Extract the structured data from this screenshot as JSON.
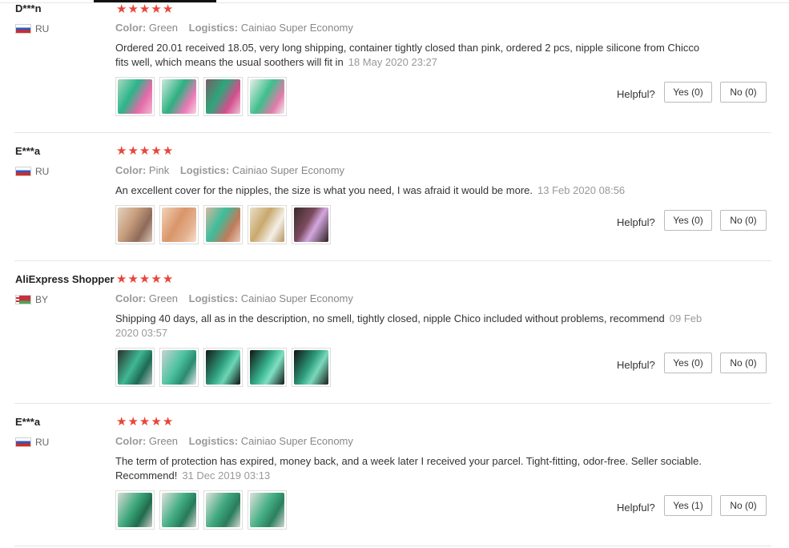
{
  "helpful_label": "Helpful?",
  "labels": {
    "color": "Color:",
    "logistics": "Logistics:"
  },
  "reviews": [
    {
      "user": "D***n",
      "country": "RU",
      "flag": "ru",
      "rating": 5,
      "color": "Green",
      "logistics": "Cainiao Super Economy",
      "text": "Ordered 20.01 received 18.05, very long shipping, container tightly closed than pink, ordered 2 pcs, nipple silicone from Chicco fits well, which means the usual soothers will fit in",
      "date": "18 May 2020 23:27",
      "yes": "Yes (0)",
      "no": "No (0)",
      "thumbs": [
        "linear-gradient(120deg,#a8d8c0,#2bb58a 40%,#e56aa8 70%,#f2b7d3)",
        "linear-gradient(120deg,#cfe9dc,#2db082 45%,#ec79b6 75%,#f7d4e6)",
        "linear-gradient(120deg,#7a5d66,#2ca77b 40%,#d44d8d 70%,#ecc3d6)",
        "linear-gradient(120deg,#e8eeea,#3fbf8d 45%,#e27aa9 75%,#f0f0f0)"
      ]
    },
    {
      "user": "E***a",
      "country": "RU",
      "flag": "ru",
      "rating": 5,
      "color": "Pink",
      "logistics": "Cainiao Super Economy",
      "text": "An excellent cover for the nipples, the size is what you need, I was afraid it would be more.",
      "date": "13 Feb 2020 08:56",
      "yes": "Yes (0)",
      "no": "No (0)",
      "thumbs": [
        "linear-gradient(120deg,#e3d2c0,#c79d7c 40%,#8e6a58 70%,#d9c4b3)",
        "linear-gradient(120deg,#f1d4bb,#d9956a 45%,#e4b290 75%,#f5e1cf)",
        "linear-gradient(120deg,#d6b7a1,#3dbd9a 40%,#c07a5b 70%,#e7cdb9)",
        "linear-gradient(120deg,#e9e0c8,#c9a86d 40%,#f3f0e7 70%,#b8935e)",
        "linear-gradient(120deg,#3a2a2a,#7b4b5e 40%,#d4a7e0 60%,#2d2222)"
      ]
    },
    {
      "user": "AliExpress Shopper",
      "country": "BY",
      "flag": "by",
      "rating": 5,
      "color": "Green",
      "logistics": "Cainiao Super Economy",
      "text": "Shipping 40 days, all as in the description, no smell, tightly closed, nipple Chico included without problems, recommend",
      "date": "09 Feb 2020 03:57",
      "yes": "Yes (0)",
      "no": "No (0)",
      "thumbs": [
        "linear-gradient(120deg,#2a2f2c,#3fb892 45%,#1d6a55 70%,#b7c3c0)",
        "linear-gradient(120deg,#c8d4d3,#4cc2a0 45%,#2a8b70 70%,#e3e9ea)",
        "linear-gradient(120deg,#151a18,#2fa07e 45%,#6cd6b5 65%,#0f1412)",
        "linear-gradient(120deg,#101413,#36b08a 45%,#7fe0c2 65%,#151918)",
        "linear-gradient(120deg,#0e1110,#2e9d7d 45%,#79d9bb 65%,#1a1f1d)"
      ]
    },
    {
      "user": "E***a",
      "country": "RU",
      "flag": "ru",
      "rating": 5,
      "color": "Green",
      "logistics": "Cainiao Super Economy",
      "text": "The term of protection has expired, money back, and a week later I received your parcel. Tight-fitting, odor-free. Seller sociable. Recommend!",
      "date": "31 Dec 2019 03:13",
      "yes": "Yes (1)",
      "no": "No (0)",
      "thumbs": [
        "linear-gradient(120deg,#d9dcd6,#3ba679 45%,#1f6b4d 70%,#c9ccc6)",
        "linear-gradient(120deg,#e0e2dd,#42ad82 45%,#267a59 70%,#d2d4cf)",
        "linear-gradient(120deg,#e2e4e0,#3ea87e 45%,#2a7c5c 70%,#d5d8d3)",
        "linear-gradient(120deg,#dfe1dc,#46b085 45%,#2a805e 70%,#d0d3ce)"
      ]
    }
  ]
}
